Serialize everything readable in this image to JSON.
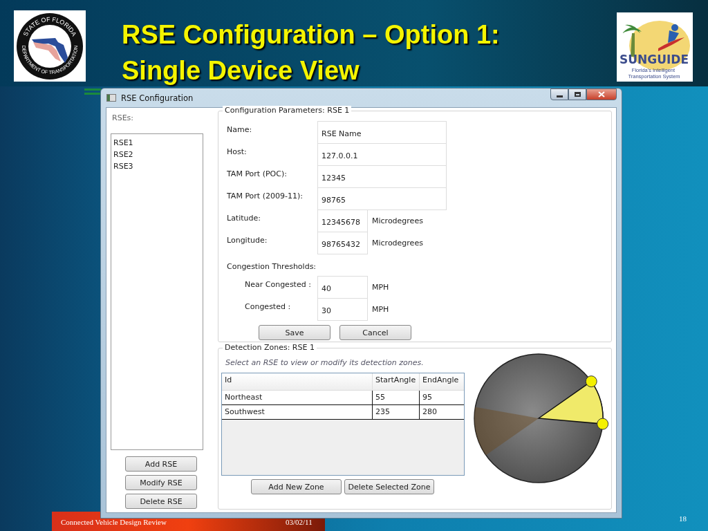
{
  "slide": {
    "title_lines": [
      "RSE Configuration – Option 1:",
      "Single Device View"
    ],
    "left_logo": {
      "top_text": "STATE OF FLORIDA",
      "bottom_text": "DEPARTMENT OF TRANSPORTATION"
    },
    "right_logo": {
      "name": "SUNGUIDE",
      "caption": "Florida's Intelligent Transportation System"
    },
    "footer": {
      "title": "Connected Vehicle Design Review",
      "date": "03/02/11",
      "page": "18"
    }
  },
  "window": {
    "title": "RSE Configuration",
    "rses_label": "RSEs:",
    "rse_list": [
      "RSE1",
      "RSE2",
      "RSE3"
    ],
    "rse_buttons": [
      "Add RSE",
      "Modify RSE",
      "Delete RSE"
    ],
    "config": {
      "legend": "Configuration Parameters: RSE 1",
      "fields": [
        {
          "kind": "wide",
          "label": "Name:",
          "value": "RSE Name"
        },
        {
          "kind": "wide",
          "label": "Host:",
          "value": "127.0.0.1"
        },
        {
          "kind": "wide",
          "label": "TAM Port (POC):",
          "value": "12345"
        },
        {
          "kind": "wide",
          "label": "TAM Port (2009-11):",
          "value": "98765"
        },
        {
          "kind": "short",
          "label": "Latitude:",
          "value": "12345678",
          "unit": "Microdegrees"
        },
        {
          "kind": "short",
          "label": "Longitude:",
          "value": "98765432",
          "unit": "Microdegrees"
        }
      ],
      "thresholds_label": "Congestion Thresholds:",
      "thresholds": [
        {
          "label": "Near Congested :",
          "value": "40",
          "unit": "MPH"
        },
        {
          "label": "Congested :",
          "value": "30",
          "unit": "MPH"
        }
      ],
      "buttons": [
        "Save",
        "Cancel"
      ]
    },
    "zones": {
      "legend": "Detection Zones: RSE 1",
      "hint": "Select an RSE to view or modify its detection zones.",
      "columns": [
        "Id",
        "StartAngle",
        "EndAngle"
      ],
      "rows": [
        {
          "cells": [
            "Northeast",
            "55",
            "95"
          ],
          "highlighted": true
        },
        {
          "cells": [
            "Southwest",
            "235",
            "280"
          ],
          "highlighted": false
        }
      ],
      "buttons": [
        "Add New Zone",
        "Delete Selected Zone"
      ]
    }
  }
}
